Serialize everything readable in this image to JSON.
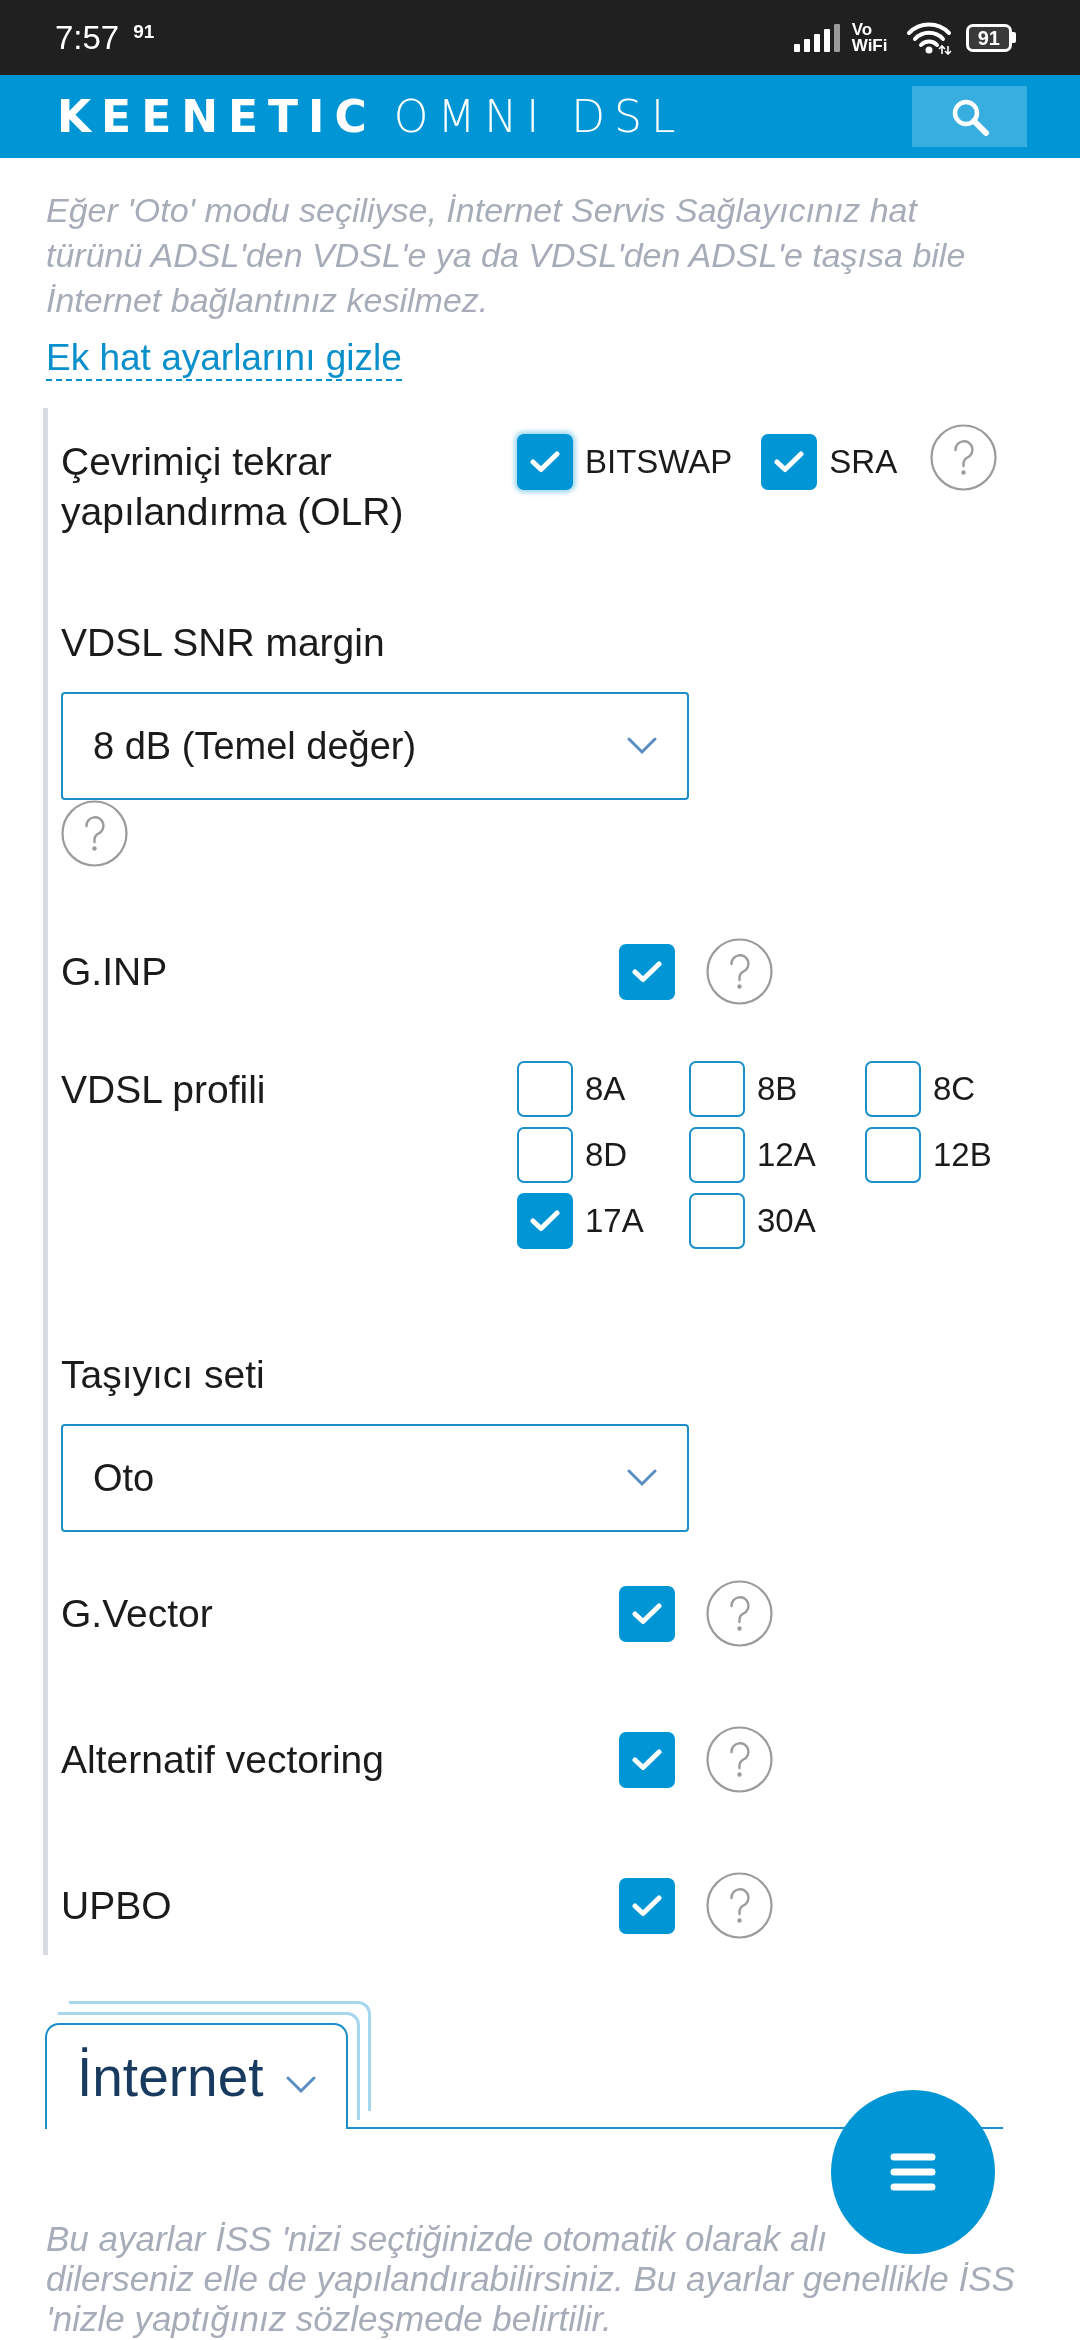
{
  "status_bar": {
    "time": "7:57",
    "indicator": "91",
    "vowifi": "Vo WiFi",
    "battery": "91"
  },
  "header": {
    "brand": "KEENETIC",
    "model": "OMNI DSL"
  },
  "intro_text": "Eğer 'Oto' modu seçiliyse, İnternet Servis Sağlayıcınız hat türünü ADSL'den VDSL'e ya da VDSL'den ADSL'e taşısa bile İnternet bağlantınız kesilmez.",
  "toggle_link": "Ek hat ayarlarını gizle",
  "settings": [
    {
      "kind": "options",
      "label": "Çevrimiçi tekrar yapılandırma (OLR)",
      "help": true,
      "options": [
        {
          "label": "BITSWAP",
          "checked": true,
          "focused": true
        },
        {
          "label": "SRA",
          "checked": true,
          "focused": false
        }
      ]
    },
    {
      "kind": "select",
      "label": "VDSL SNR margin",
      "value": "8 dB (Temel değer)",
      "help": true
    },
    {
      "kind": "checkbox",
      "label": "G.INP",
      "checked": true,
      "help": true
    },
    {
      "kind": "grid",
      "label": "VDSL profili",
      "help": false,
      "options": [
        {
          "label": "8A",
          "checked": false
        },
        {
          "label": "8B",
          "checked": false
        },
        {
          "label": "8C",
          "checked": false
        },
        {
          "label": "8D",
          "checked": false
        },
        {
          "label": "12A",
          "checked": false
        },
        {
          "label": "12B",
          "checked": false
        },
        {
          "label": "17A",
          "checked": true
        },
        {
          "label": "30A",
          "checked": false
        }
      ]
    },
    {
      "kind": "select",
      "label": "Taşıyıcı seti",
      "value": "Oto",
      "help": false
    },
    {
      "kind": "checkbox",
      "label": "G.Vector",
      "checked": true,
      "help": true
    },
    {
      "kind": "checkbox",
      "label": "Alternatif vectoring",
      "checked": true,
      "help": true
    },
    {
      "kind": "checkbox",
      "label": "UPBO",
      "checked": true,
      "help": true
    }
  ],
  "section_tab": {
    "label": "İnternet"
  },
  "info_lines": [
    "Bu ayarlar İSS 'nizi seçtiğinizde otomatik olarak alı",
    "dilerseniz elle de yapılandırabilirsiniz. Bu ayarlar genellikle İSS",
    "'nizle yaptığınız sözleşmede belirtilir."
  ]
}
